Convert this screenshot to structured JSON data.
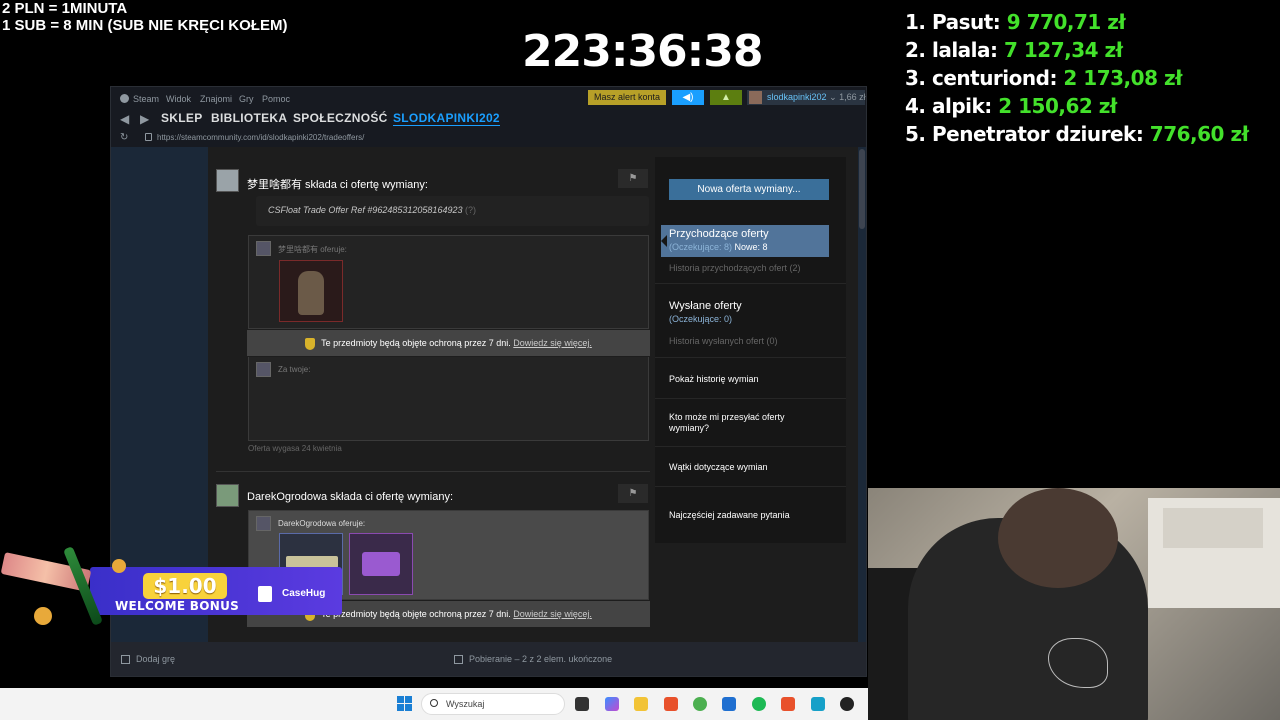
{
  "overlay": {
    "rate_line1": "2 PLN =  1MINUTA",
    "rate_line2": "1 SUB = 8 MIN (SUB NIE KRĘCI KOŁEM)",
    "timer": "223:36:38",
    "leaderboard": [
      {
        "name": "1. Pasut: ",
        "amount": "9 770,71 zł"
      },
      {
        "name": "2. lalala: ",
        "amount": "7 127,34 zł"
      },
      {
        "name": "3. centuriond: ",
        "amount": "2 173,08 zł"
      },
      {
        "name": "4. alpik: ",
        "amount": "2 150,62 zł"
      },
      {
        "name": "5. Penetrator dziurek: ",
        "amount": "776,60 zł"
      }
    ]
  },
  "steam": {
    "menu": [
      "Steam",
      "Widok",
      "Znajomi",
      "Gry",
      "Pomoc"
    ],
    "alert_button": "Masz alert konta",
    "username": "slodkapinki202",
    "balance": "1,66 zł",
    "tabs": [
      "SKLEP",
      "BIBLIOTEKA",
      "SPOŁECZNOŚĆ",
      "SLODKAPINKI202"
    ],
    "url": "https://steamcommunity.com/id/slodkapinki202/tradeoffers/",
    "offers": [
      {
        "header": "梦里啥都有 składa ci ofertę wymiany:",
        "message": "CSFloat Trade Offer Ref #962485312058164923",
        "message_q": "(?)",
        "offers_label": "梦里啥都有 oferuje:",
        "protection_text": "Te przedmioty będą objęte ochroną przez 7 dni. ",
        "protection_link": "Dowiedz się więcej.",
        "for_you_label": "Za twoje:",
        "expires": "Oferta wygasa 24 kwietnia"
      },
      {
        "header": "DarekOgrodowa składa ci ofertę wymiany:",
        "offers_label": "DarekOgrodowa oferuje:",
        "protection_text": "Te przedmioty będą objęte ochroną przez 7 dni. ",
        "protection_link": "Dowiedz się więcej."
      }
    ],
    "sidebar": {
      "new_offer": "Nowa oferta wymiany...",
      "incoming_title": "Przychodzące oferty",
      "incoming_pending": "(Oczekujące: 8)",
      "incoming_new": "Nowe: 8",
      "incoming_history": "Historia przychodzących ofert (2)",
      "sent_title": "Wysłane oferty",
      "sent_pending": "(Oczekujące: 0)",
      "sent_history": "Historia wysłanych ofert (0)",
      "link_history": "Pokaż historię wymian",
      "link_who": "Kto może mi przesyłać oferty wymiany?",
      "link_threads": "Wątki dotyczące wymian",
      "link_faq": "Najczęściej zadawane pytania"
    },
    "status": {
      "add_game": "Dodaj grę",
      "download": "Pobieranie – 2 z 2 elem. ukończone"
    }
  },
  "promo": {
    "amount": "$1.00",
    "bonus": "WELCOME BONUS",
    "brand": "CaseHug"
  },
  "taskbar": {
    "search_placeholder": "Wyszukaj"
  },
  "colors": {
    "steam_blue": "#1a9fff",
    "leaderboard_green": "#43e12b",
    "alert_yellow": "#b7a028"
  }
}
